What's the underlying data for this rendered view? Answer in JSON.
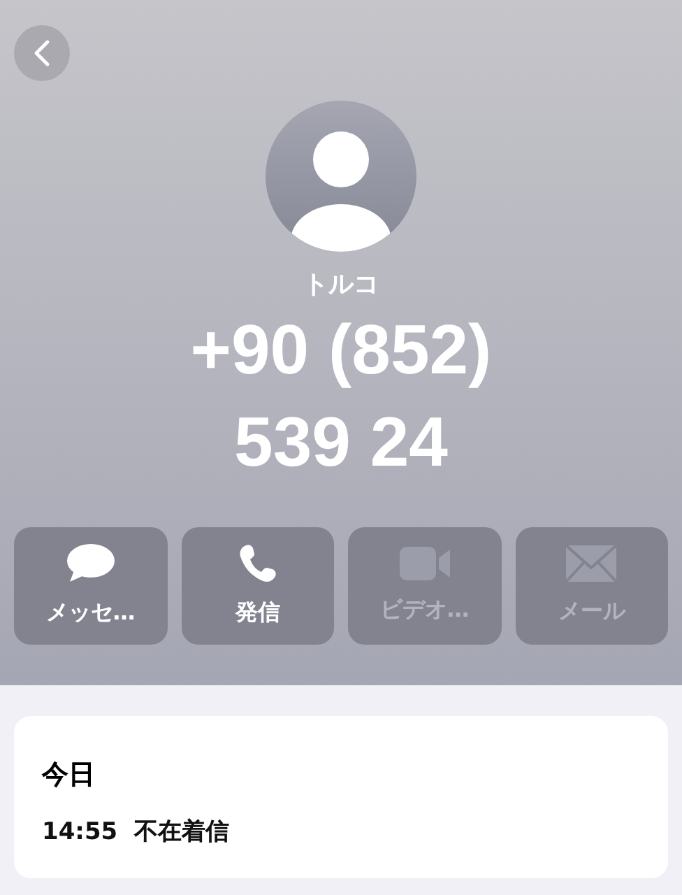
{
  "header": {
    "name": "トルコ",
    "number": "+90 (852) 539 24"
  },
  "actions": [
    {
      "kind": "message",
      "label": "メッセ…",
      "disabled": false
    },
    {
      "kind": "phone",
      "label": "発信",
      "disabled": false
    },
    {
      "kind": "video",
      "label": "ビデオ…",
      "disabled": true
    },
    {
      "kind": "mail",
      "label": "メール",
      "disabled": true
    }
  ],
  "history": {
    "day": "今日",
    "entries": [
      {
        "time": "14:55",
        "type": "不在着信"
      }
    ]
  }
}
